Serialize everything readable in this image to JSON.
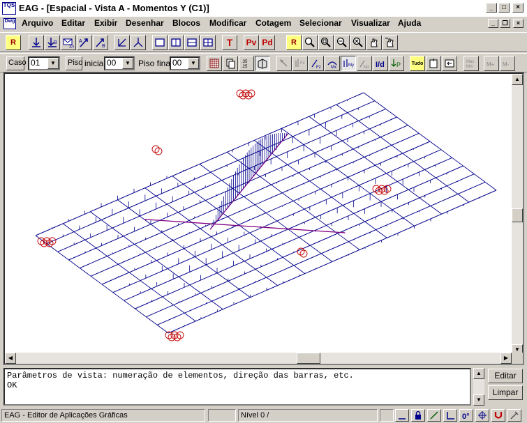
{
  "window": {
    "title": "EAG - [Espacial - Vista A - Momentos Y (C1)]",
    "app_icon_text": "TQS",
    "doc_icon_text": "Dwg"
  },
  "menu": [
    {
      "label": "Arquivo"
    },
    {
      "label": "Editar"
    },
    {
      "label": "Exibir"
    },
    {
      "label": "Desenhar"
    },
    {
      "label": "Blocos"
    },
    {
      "label": "Modificar"
    },
    {
      "label": "Cotagem"
    },
    {
      "label": "Selecionar"
    },
    {
      "label": "Visualizar"
    },
    {
      "label": "Ajuda"
    }
  ],
  "toolbar1": {
    "r_label": "R",
    "t_label": "T",
    "pv_label": "Pv",
    "pd_label": "Pd",
    "r2_label": "R"
  },
  "toolbar2": {
    "caso_label": "Caso",
    "caso_value": "01",
    "piso_label": "Piso",
    "inicial_label": "inicial",
    "piso_inicial_value": "00",
    "piso_final_label": "Piso final",
    "piso_final_value": "00",
    "tudo_label": "Tudo"
  },
  "console": {
    "lines": [
      "Parâmetros de vista: numeração de elementos, direção das barras, etc.",
      "OK"
    ]
  },
  "side_buttons": {
    "editar": "Editar",
    "limpar": "Limpar"
  },
  "status": {
    "app_name": "EAG - Editor de Aplicações Gráficas",
    "level": "Nível 0 /"
  },
  "colors": {
    "drawing_blue": "#00008b",
    "drawing_red": "#c00000",
    "drawing_purple": "#800080",
    "accent_yellow": "#ffff80"
  }
}
